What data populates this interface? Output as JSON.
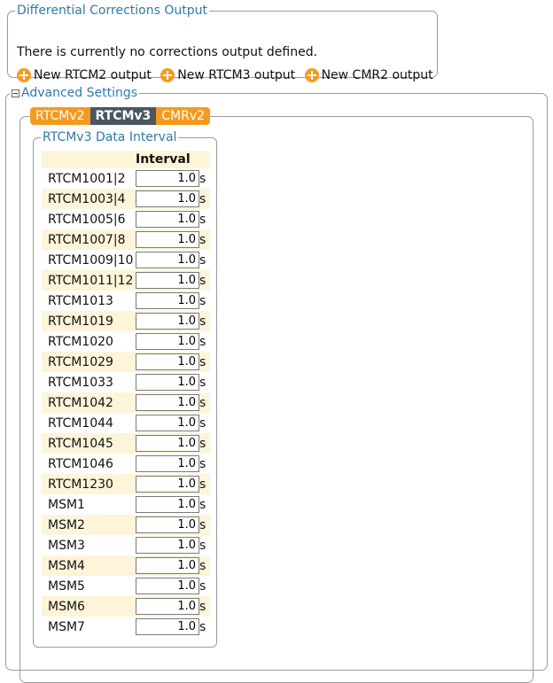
{
  "corrections": {
    "legend": "Differential Corrections Output",
    "message": "There is currently no corrections output defined.",
    "links": [
      "New RTCM2 output",
      "New RTCM3 output",
      "New CMR2 output"
    ]
  },
  "advanced": {
    "legend": "Advanced Settings",
    "tabs": [
      "RTCMv2",
      "RTCMv3",
      "CMRv2"
    ],
    "active_tab": "RTCMv3",
    "interval_legend": "RTCMv3 Data Interval",
    "interval_header": "Interval",
    "unit": "s",
    "rows": [
      {
        "name": "RTCM1001|2",
        "value": "1.0"
      },
      {
        "name": "RTCM1003|4",
        "value": "1.0"
      },
      {
        "name": "RTCM1005|6",
        "value": "1.0"
      },
      {
        "name": "RTCM1007|8",
        "value": "1.0"
      },
      {
        "name": "RTCM1009|10",
        "value": "1.0"
      },
      {
        "name": "RTCM1011|12",
        "value": "1.0"
      },
      {
        "name": "RTCM1013",
        "value": "1.0"
      },
      {
        "name": "RTCM1019",
        "value": "1.0"
      },
      {
        "name": "RTCM1020",
        "value": "1.0"
      },
      {
        "name": "RTCM1029",
        "value": "1.0"
      },
      {
        "name": "RTCM1033",
        "value": "1.0"
      },
      {
        "name": "RTCM1042",
        "value": "1.0"
      },
      {
        "name": "RTCM1044",
        "value": "1.0"
      },
      {
        "name": "RTCM1045",
        "value": "1.0"
      },
      {
        "name": "RTCM1046",
        "value": "1.0"
      },
      {
        "name": "RTCM1230",
        "value": "1.0"
      },
      {
        "name": "MSM1",
        "value": "1.0"
      },
      {
        "name": "MSM2",
        "value": "1.0"
      },
      {
        "name": "MSM3",
        "value": "1.0"
      },
      {
        "name": "MSM4",
        "value": "1.0"
      },
      {
        "name": "MSM5",
        "value": "1.0"
      },
      {
        "name": "MSM6",
        "value": "1.0"
      },
      {
        "name": "MSM7",
        "value": "1.0"
      }
    ]
  },
  "colors": {
    "accent_orange": "#f49b1f",
    "active_tab": "#4b5662",
    "legend_blue": "#2f7aa6"
  }
}
